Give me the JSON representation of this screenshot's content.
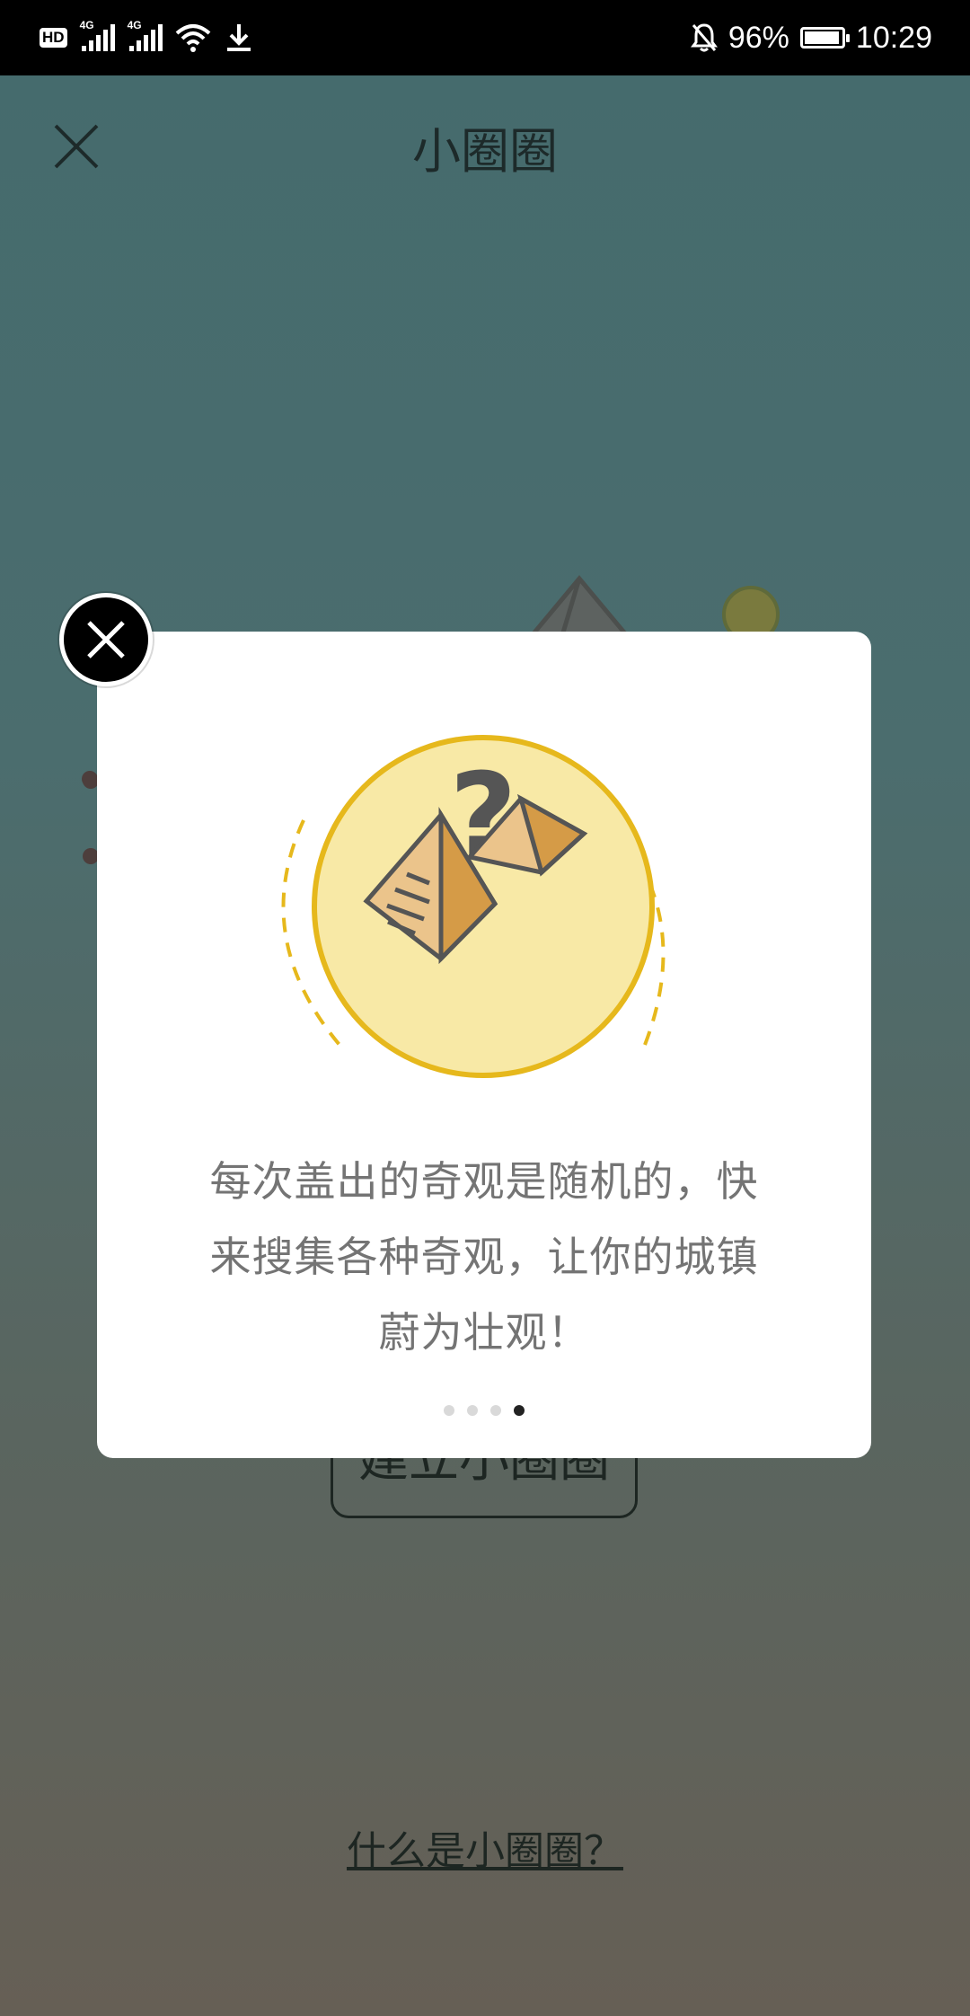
{
  "status_bar": {
    "left_icons": [
      "hd-icon",
      "signal-4g-icon",
      "signal-4g-icon",
      "wifi-icon",
      "download-icon"
    ],
    "hd_label": "HD",
    "network_label": "4G",
    "battery_percent": "96%",
    "battery_level": 0.96,
    "time": "10:29"
  },
  "header": {
    "title": "小圈圈",
    "close_icon": "close-icon"
  },
  "background_page": {
    "build_button_label": "建立小圈圈",
    "what_link": "什么是小圈圈？"
  },
  "modal": {
    "close_icon": "close-circle-icon",
    "illustration_icon": "pyramid-question-icon",
    "description": "每次盖出的奇观是随机的，快来搜集各种奇观，让你的城镇蔚为壮观！",
    "description_lines": [
      "每次盖出的奇观是随机的，快",
      "来搜集各种奇观，让你的城镇",
      "蔚为壮观！"
    ],
    "pager": {
      "total": 4,
      "active_index": 3
    }
  },
  "colors": {
    "accent_yellow": "#e6b81c",
    "circle_fill": "#f8e9a6",
    "pyramid_light": "#ebc48b",
    "pyramid_dark": "#d59b47",
    "outline": "#555555"
  }
}
